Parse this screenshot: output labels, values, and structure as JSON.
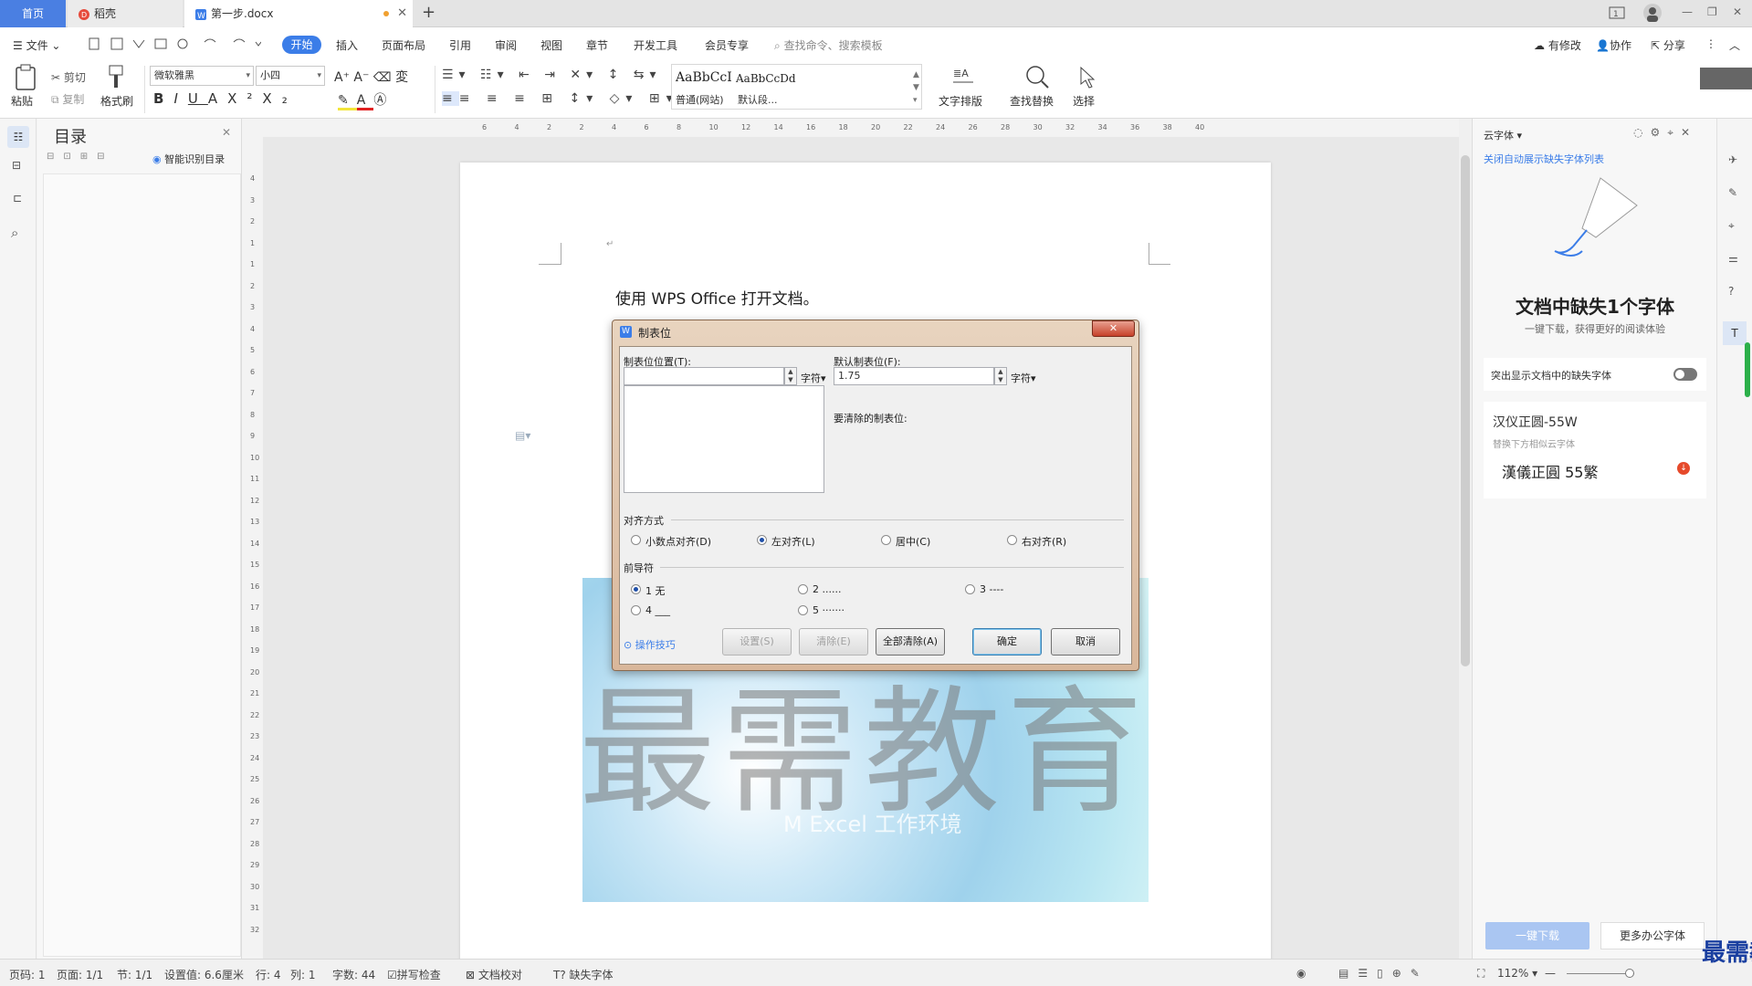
{
  "tabs": {
    "home": "首页",
    "daoke": "稻壳",
    "doc": "第一步.docx",
    "new": "+"
  },
  "menu": {
    "file": "文件",
    "items": [
      "开始",
      "插入",
      "页面布局",
      "引用",
      "审阅",
      "视图",
      "章节",
      "开发工具",
      "会员专享"
    ],
    "search_placeholder": "查找命令、搜索模板",
    "right": [
      "有修改",
      "协作",
      "分享"
    ]
  },
  "ribbon": {
    "paste": "粘贴",
    "cut": "剪切",
    "copy": "复制",
    "format_painter": "格式刷",
    "font": "微软雅黑",
    "size": "小四",
    "style1_sample": "AaBbCcI",
    "style1": "普通(网站)",
    "style2_sample": "AaBbCcDd",
    "style2": "默认段...",
    "text_layout": "文字排版",
    "find_replace": "查找替换",
    "select": "选择"
  },
  "toc": {
    "title": "目录",
    "smart": "智能识别目录"
  },
  "ruler": {
    "h": [
      "6",
      "4",
      "2",
      "2",
      "4",
      "6",
      "8",
      "10",
      "12",
      "14",
      "16",
      "18",
      "20",
      "22",
      "24",
      "26",
      "28",
      "30",
      "32",
      "34",
      "36",
      "38",
      "40"
    ],
    "v": [
      "4",
      "3",
      "2",
      "1",
      "1",
      "2",
      "3",
      "4",
      "5",
      "6",
      "7",
      "8",
      "9",
      "10",
      "11",
      "12",
      "13",
      "14",
      "15",
      "16",
      "17",
      "18",
      "19",
      "20",
      "21",
      "22",
      "23",
      "24",
      "25",
      "26",
      "27",
      "28",
      "29",
      "30",
      "31",
      "32"
    ]
  },
  "doc": {
    "line1": "使用 WPS Office 打开文档。",
    "watermark": "最需教育",
    "img_caption": "M Excel 工作环境"
  },
  "dialog": {
    "title": "制表位",
    "pos_label": "制表位位置(T):",
    "pos_value": "",
    "unit": "字符",
    "default_label": "默认制表位(F):",
    "default_value": "1.75",
    "clear_label": "要清除的制表位:",
    "align_title": "对齐方式",
    "align": [
      "小数点对齐(D)",
      "左对齐(L)",
      "居中(C)",
      "右对齐(R)"
    ],
    "align_selected": 1,
    "leader_title": "前导符",
    "leaders": [
      "1 无",
      "2 ......",
      "3 ----",
      "4 ___",
      "5 ·······"
    ],
    "leader_selected": 0,
    "tips": "操作技巧",
    "set": "设置(S)",
    "clear": "清除(E)",
    "clear_all": "全部清除(A)",
    "ok": "确定",
    "cancel": "取消",
    "close": "✕"
  },
  "cloudfont": {
    "title": "云字体",
    "link": "关闭自动展示缺失字体列表",
    "heading": "文档中缺失1个字体",
    "sub": "一键下载，获得更好的阅读体验",
    "highlight": "突出显示文档中的缺失字体",
    "font_name": "汉仪正圆-55W",
    "replace_hint": "替换下方相似云字体",
    "font_sample": "漢儀正圓 55繁",
    "download": "一键下载",
    "more": "更多办公字体"
  },
  "status": {
    "page": "页码: 1",
    "pages": "页面: 1/1",
    "section": "节: 1/1",
    "setting": "设置值: 6.6厘米",
    "row": "行: 4",
    "col": "列: 1",
    "words": "字数: 44",
    "spell": "拼写检查",
    "proof": "文档校对",
    "missing": "缺失字体",
    "zoom": "112%"
  },
  "brand": "最需教育",
  "colors": {
    "accent": "#3b7de8",
    "brand_text": "#1a3fa0"
  }
}
